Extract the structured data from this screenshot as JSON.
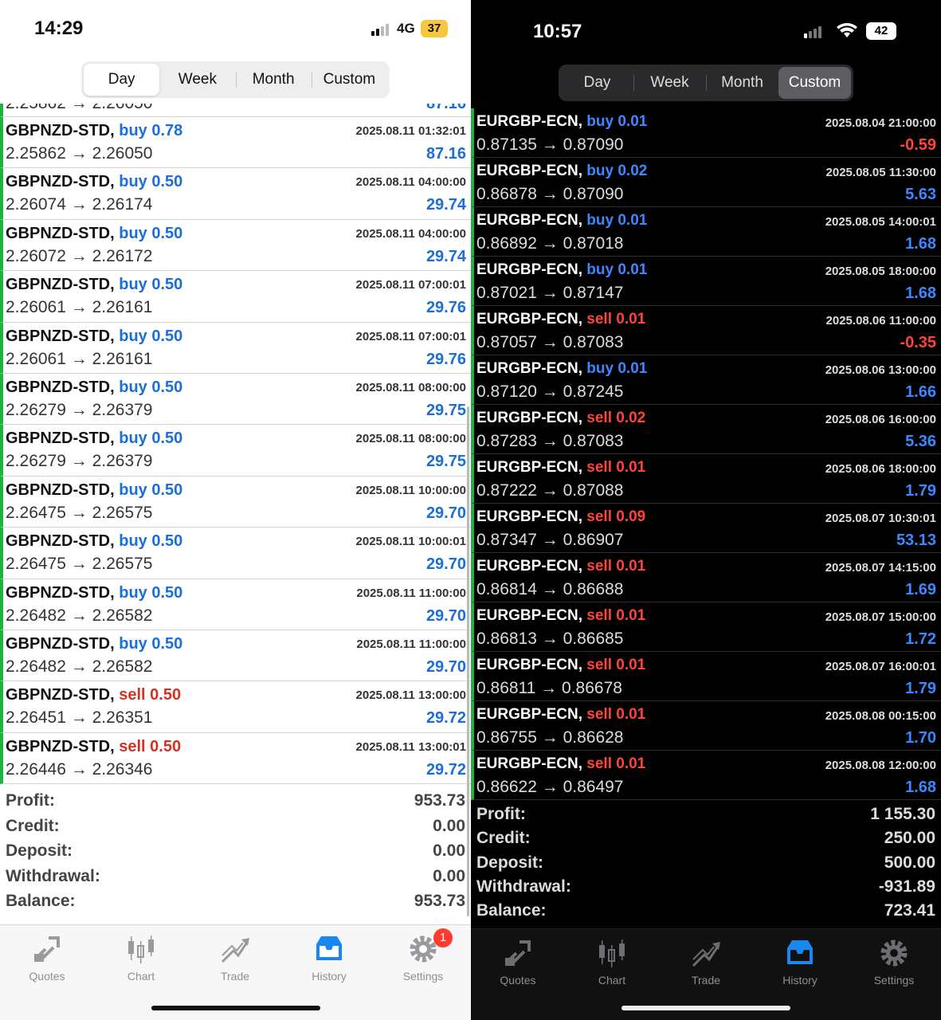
{
  "left": {
    "status": {
      "time": "14:29",
      "network": "4G",
      "battery": "37"
    },
    "segments": [
      {
        "label": "Day",
        "selected": true
      },
      {
        "label": "Week",
        "selected": false
      },
      {
        "label": "Month",
        "selected": false
      },
      {
        "label": "Custom",
        "selected": false
      }
    ],
    "partial_row": {
      "prices": "2.25862 → 2.26050",
      "profit": "87.16"
    },
    "deals": [
      {
        "symbol": "GBPNZD-STD,",
        "action": "buy 0.78",
        "side": "buy",
        "prices": "2.25862 → 2.26050",
        "time": "2025.08.11 01:32:01",
        "profit": "87.16"
      },
      {
        "symbol": "GBPNZD-STD,",
        "action": "buy 0.50",
        "side": "buy",
        "prices": "2.26074 → 2.26174",
        "time": "2025.08.11 04:00:00",
        "profit": "29.74"
      },
      {
        "symbol": "GBPNZD-STD,",
        "action": "buy 0.50",
        "side": "buy",
        "prices": "2.26072 → 2.26172",
        "time": "2025.08.11 04:00:00",
        "profit": "29.74"
      },
      {
        "symbol": "GBPNZD-STD,",
        "action": "buy 0.50",
        "side": "buy",
        "prices": "2.26061 → 2.26161",
        "time": "2025.08.11 07:00:01",
        "profit": "29.76"
      },
      {
        "symbol": "GBPNZD-STD,",
        "action": "buy 0.50",
        "side": "buy",
        "prices": "2.26061 → 2.26161",
        "time": "2025.08.11 07:00:01",
        "profit": "29.76"
      },
      {
        "symbol": "GBPNZD-STD,",
        "action": "buy 0.50",
        "side": "buy",
        "prices": "2.26279 → 2.26379",
        "time": "2025.08.11 08:00:00",
        "profit": "29.75"
      },
      {
        "symbol": "GBPNZD-STD,",
        "action": "buy 0.50",
        "side": "buy",
        "prices": "2.26279 → 2.26379",
        "time": "2025.08.11 08:00:00",
        "profit": "29.75"
      },
      {
        "symbol": "GBPNZD-STD,",
        "action": "buy 0.50",
        "side": "buy",
        "prices": "2.26475 → 2.26575",
        "time": "2025.08.11 10:00:00",
        "profit": "29.70"
      },
      {
        "symbol": "GBPNZD-STD,",
        "action": "buy 0.50",
        "side": "buy",
        "prices": "2.26475 → 2.26575",
        "time": "2025.08.11 10:00:01",
        "profit": "29.70"
      },
      {
        "symbol": "GBPNZD-STD,",
        "action": "buy 0.50",
        "side": "buy",
        "prices": "2.26482 → 2.26582",
        "time": "2025.08.11 11:00:00",
        "profit": "29.70"
      },
      {
        "symbol": "GBPNZD-STD,",
        "action": "buy 0.50",
        "side": "buy",
        "prices": "2.26482 → 2.26582",
        "time": "2025.08.11 11:00:00",
        "profit": "29.70"
      },
      {
        "symbol": "GBPNZD-STD,",
        "action": "sell 0.50",
        "side": "sell",
        "prices": "2.26451 → 2.26351",
        "time": "2025.08.11 13:00:00",
        "profit": "29.72"
      },
      {
        "symbol": "GBPNZD-STD,",
        "action": "sell 0.50",
        "side": "sell",
        "prices": "2.26446 → 2.26346",
        "time": "2025.08.11 13:00:01",
        "profit": "29.72"
      }
    ],
    "summary": [
      {
        "label": "Profit:",
        "value": "953.73"
      },
      {
        "label": "Credit:",
        "value": "0.00"
      },
      {
        "label": "Deposit:",
        "value": "0.00"
      },
      {
        "label": "Withdrawal:",
        "value": "0.00"
      },
      {
        "label": "Balance:",
        "value": "953.73"
      }
    ],
    "tabs": [
      {
        "label": "Quotes",
        "icon": "quotes-icon"
      },
      {
        "label": "Chart",
        "icon": "chart-icon"
      },
      {
        "label": "Trade",
        "icon": "trade-icon"
      },
      {
        "label": "History",
        "icon": "history-icon",
        "active": true
      },
      {
        "label": "Settings",
        "icon": "settings-icon",
        "badge": "1"
      }
    ]
  },
  "right": {
    "status": {
      "time": "10:57",
      "battery": "42"
    },
    "segments": [
      {
        "label": "Day",
        "selected": false
      },
      {
        "label": "Week",
        "selected": false
      },
      {
        "label": "Month",
        "selected": false
      },
      {
        "label": "Custom",
        "selected": true
      }
    ],
    "deals": [
      {
        "symbol": "EURGBP-ECN,",
        "action": "buy 0.01",
        "side": "buy",
        "prices": "0.87135 → 0.87090",
        "time": "2025.08.04 21:00:00",
        "profit": "-0.59"
      },
      {
        "symbol": "EURGBP-ECN,",
        "action": "buy 0.02",
        "side": "buy",
        "prices": "0.86878 → 0.87090",
        "time": "2025.08.05 11:30:00",
        "profit": "5.63"
      },
      {
        "symbol": "EURGBP-ECN,",
        "action": "buy 0.01",
        "side": "buy",
        "prices": "0.86892 → 0.87018",
        "time": "2025.08.05 14:00:01",
        "profit": "1.68"
      },
      {
        "symbol": "EURGBP-ECN,",
        "action": "buy 0.01",
        "side": "buy",
        "prices": "0.87021 → 0.87147",
        "time": "2025.08.05 18:00:00",
        "profit": "1.68"
      },
      {
        "symbol": "EURGBP-ECN,",
        "action": "sell 0.01",
        "side": "sell",
        "prices": "0.87057 → 0.87083",
        "time": "2025.08.06 11:00:00",
        "profit": "-0.35"
      },
      {
        "symbol": "EURGBP-ECN,",
        "action": "buy 0.01",
        "side": "buy",
        "prices": "0.87120 → 0.87245",
        "time": "2025.08.06 13:00:00",
        "profit": "1.66"
      },
      {
        "symbol": "EURGBP-ECN,",
        "action": "sell 0.02",
        "side": "sell",
        "prices": "0.87283 → 0.87083",
        "time": "2025.08.06 16:00:00",
        "profit": "5.36"
      },
      {
        "symbol": "EURGBP-ECN,",
        "action": "sell 0.01",
        "side": "sell",
        "prices": "0.87222 → 0.87088",
        "time": "2025.08.06 18:00:00",
        "profit": "1.79"
      },
      {
        "symbol": "EURGBP-ECN,",
        "action": "sell 0.09",
        "side": "sell",
        "prices": "0.87347 → 0.86907",
        "time": "2025.08.07 10:30:01",
        "profit": "53.13"
      },
      {
        "symbol": "EURGBP-ECN,",
        "action": "sell 0.01",
        "side": "sell",
        "prices": "0.86814 → 0.86688",
        "time": "2025.08.07 14:15:00",
        "profit": "1.69"
      },
      {
        "symbol": "EURGBP-ECN,",
        "action": "sell 0.01",
        "side": "sell",
        "prices": "0.86813 → 0.86685",
        "time": "2025.08.07 15:00:00",
        "profit": "1.72"
      },
      {
        "symbol": "EURGBP-ECN,",
        "action": "sell 0.01",
        "side": "sell",
        "prices": "0.86811 → 0.86678",
        "time": "2025.08.07 16:00:01",
        "profit": "1.79"
      },
      {
        "symbol": "EURGBP-ECN,",
        "action": "sell 0.01",
        "side": "sell",
        "prices": "0.86755 → 0.86628",
        "time": "2025.08.08 00:15:00",
        "profit": "1.70"
      },
      {
        "symbol": "EURGBP-ECN,",
        "action": "sell 0.01",
        "side": "sell",
        "prices": "0.86622 → 0.86497",
        "time": "2025.08.08 12:00:00",
        "profit": "1.68"
      }
    ],
    "summary": [
      {
        "label": "Profit:",
        "value": "1 155.30"
      },
      {
        "label": "Credit:",
        "value": "250.00"
      },
      {
        "label": "Deposit:",
        "value": "500.00"
      },
      {
        "label": "Withdrawal:",
        "value": "-931.89"
      },
      {
        "label": "Balance:",
        "value": "723.41"
      }
    ],
    "tabs": [
      {
        "label": "Quotes",
        "icon": "quotes-icon"
      },
      {
        "label": "Chart",
        "icon": "chart-icon"
      },
      {
        "label": "Trade",
        "icon": "trade-icon"
      },
      {
        "label": "History",
        "icon": "history-icon",
        "active": true
      },
      {
        "label": "Settings",
        "icon": "settings-icon"
      }
    ]
  },
  "colors": {
    "buy": "#1a6ed8",
    "sell": "#d33222",
    "win_bar": "#1fb141",
    "active_tab": "#1a86f0",
    "badge": "#ff3b30"
  }
}
